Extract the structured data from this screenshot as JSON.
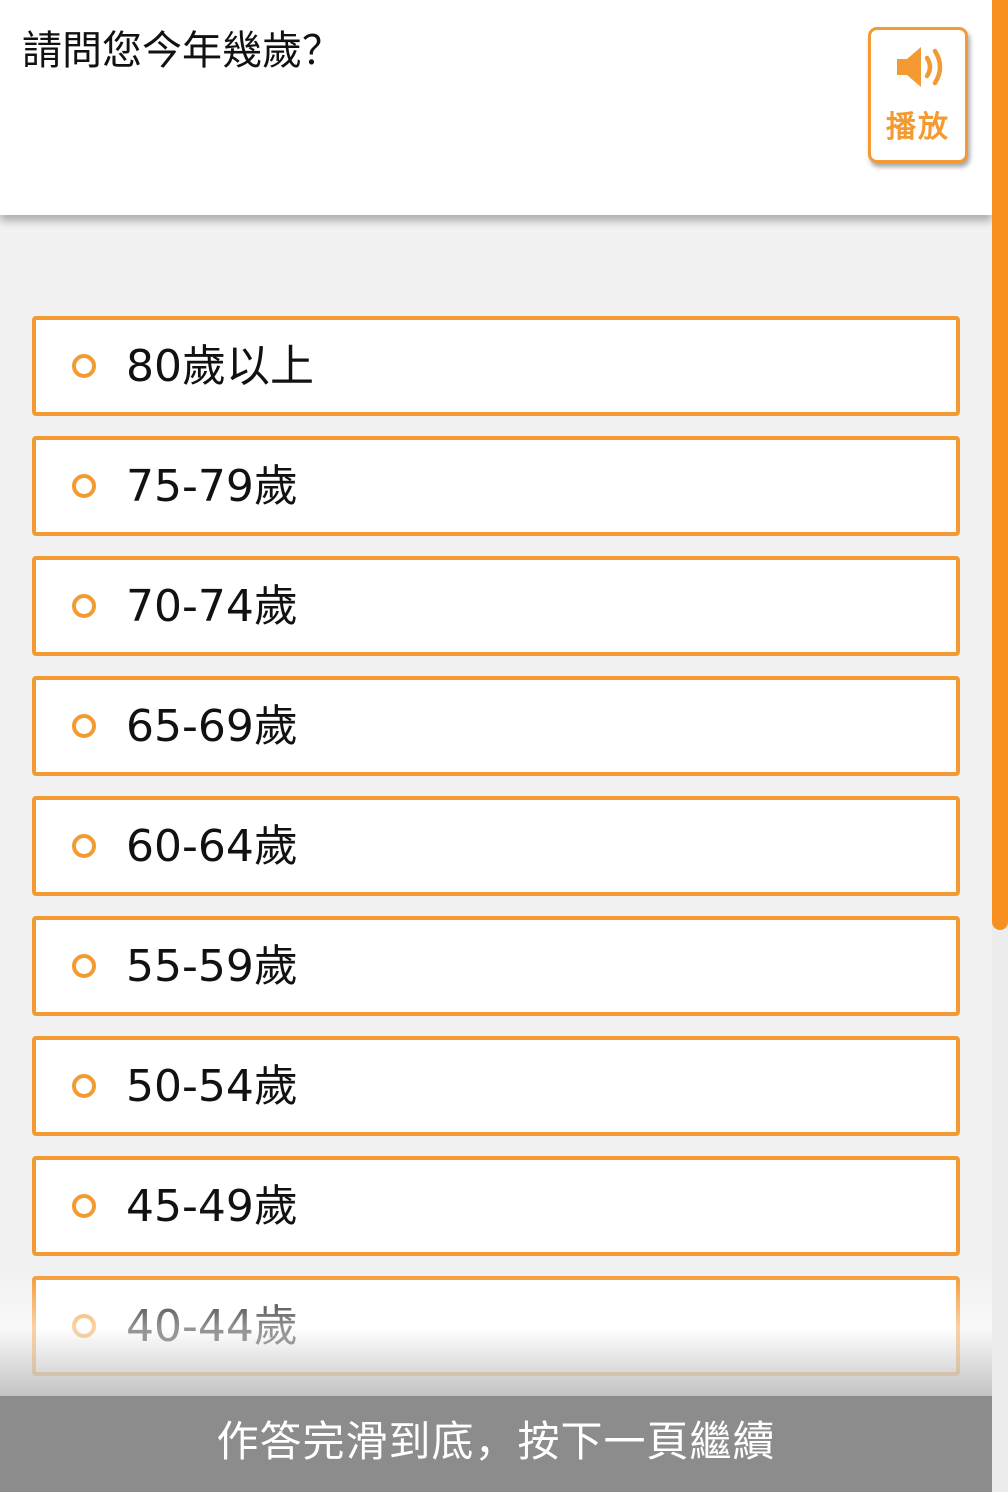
{
  "question": {
    "text": "請問您今年幾歲？"
  },
  "play_button": {
    "label": "播放",
    "icon": "speaker-icon"
  },
  "options": [
    {
      "label": "80歲以上"
    },
    {
      "label": "75-79歲"
    },
    {
      "label": "70-74歲"
    },
    {
      "label": "65-69歲"
    },
    {
      "label": "60-64歲"
    },
    {
      "label": "55-59歲"
    },
    {
      "label": "50-54歲"
    },
    {
      "label": "45-49歲"
    },
    {
      "label": "40-44歲"
    }
  ],
  "footer": {
    "text": "作答完滑到底，按下一頁繼續"
  },
  "colors": {
    "accent": "#f39a33",
    "scrollbar": "#f7901e",
    "footer_bg": "#8c8c8c",
    "page_bg": "#f1f1f1"
  }
}
